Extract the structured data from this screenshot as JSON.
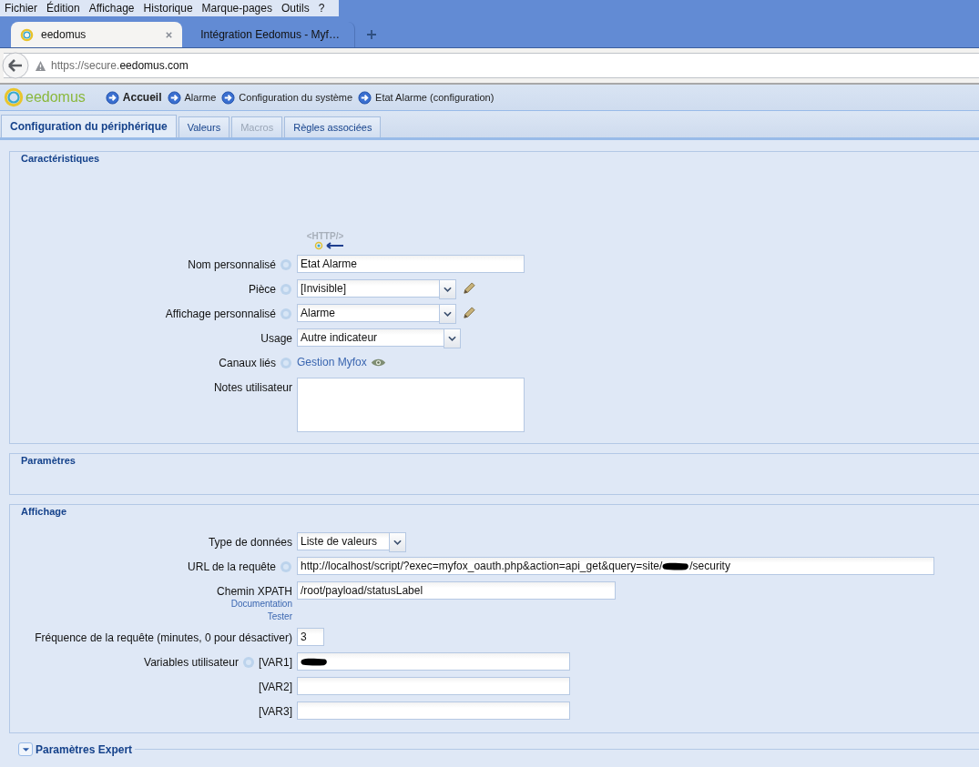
{
  "menu": [
    {
      "label": "Fichier"
    },
    {
      "label": "Édition"
    },
    {
      "label": "Affichage"
    },
    {
      "label": "Historique"
    },
    {
      "label": "Marque-pages"
    },
    {
      "label": "Outils"
    },
    {
      "label": "?"
    }
  ],
  "browser_tabs": [
    {
      "title": "eedomus",
      "selected": true
    },
    {
      "title": "Intégration Eedomus - Myf…",
      "selected": false
    }
  ],
  "address": {
    "prefix": "https://secure.",
    "domain": "eedomus.com"
  },
  "app": {
    "logo": "eedomus",
    "breadcrumbs": [
      {
        "label": "Accueil",
        "kind": "home"
      },
      {
        "label": "Alarme",
        "kind": "page"
      },
      {
        "label": "Configuration du système",
        "kind": "page"
      },
      {
        "label": "Etat Alarme (configuration)",
        "kind": "page"
      }
    ]
  },
  "page_tabs": [
    {
      "label": "Configuration du périphérique",
      "selected": true,
      "disabled": false
    },
    {
      "label": "Valeurs",
      "selected": false,
      "disabled": false
    },
    {
      "label": "Macros",
      "selected": false,
      "disabled": true
    },
    {
      "label": "Règles associées",
      "selected": false,
      "disabled": false
    }
  ],
  "sections": [
    {
      "title": "Caractéristiques",
      "expanded": true,
      "device_icon_text": "<HTTP/>",
      "fields": [
        {
          "label": "Nom personnalisé",
          "help": true,
          "kind": "text",
          "value": "Etat Alarme"
        },
        {
          "label": "Pièce",
          "help": true,
          "kind": "select",
          "value": "[Invisible]",
          "editable": true
        },
        {
          "label": "Affichage personnalisé",
          "help": true,
          "kind": "select",
          "value": "Alarme",
          "editable": true
        },
        {
          "label": "Usage",
          "help": false,
          "kind": "select",
          "value": "Autre indicateur",
          "editable": false
        },
        {
          "label": "Canaux liés",
          "help": true,
          "kind": "link",
          "value": "Gestion Myfox"
        },
        {
          "label": "Notes utilisateur",
          "help": false,
          "kind": "textarea"
        }
      ]
    },
    {
      "title": "Paramètres",
      "expanded": true
    },
    {
      "title": "Affichage",
      "expanded": true,
      "fields": [
        {
          "label": "Type de données",
          "help": false,
          "kind": "select",
          "value": "Liste de valeurs",
          "editable": false
        },
        {
          "label": "URL de la requête",
          "help": true,
          "kind": "text",
          "value": "http://localhost/script/?exec=myfox_oauth.php&action=api_get&query=site/",
          "redacted": true,
          "value_after": "/security"
        },
        {
          "label": "Chemin XPATH",
          "help": false,
          "kind": "text",
          "value": "/root/payload/statusLabel",
          "links": [
            "Documentation",
            "Tester"
          ]
        },
        {
          "label": "Fréquence de la requête (minutes, 0 pour désactiver)",
          "help": false,
          "kind": "text",
          "value": "3"
        },
        {
          "label": "Variables utilisateur",
          "help": true,
          "tag": "[VAR1]",
          "kind": "text",
          "redacted": true
        },
        {
          "tag": "[VAR2]",
          "help": false,
          "kind": "text"
        },
        {
          "tag": "[VAR3]",
          "help": false,
          "kind": "text"
        }
      ]
    },
    {
      "title": "Paramètres Expert",
      "expanded": false
    }
  ]
}
